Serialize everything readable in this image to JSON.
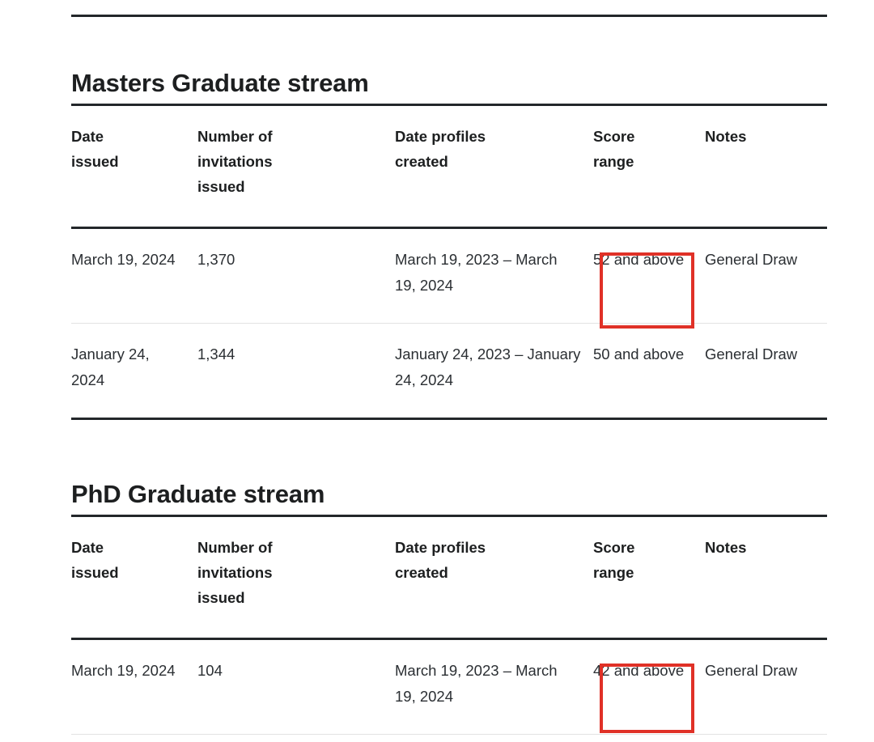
{
  "columns": [
    "Date issued",
    "Number of invitations issued",
    "Date profiles created",
    "Score range",
    "Notes"
  ],
  "columns_lines": {
    "c0_l1": "Date",
    "c0_l2": "issued",
    "c1_l1": "Number of",
    "c1_l2": "invitations",
    "c1_l3": "issued",
    "c2_l1": "Date profiles",
    "c2_l2": "created",
    "c3_l1": "Score",
    "c3_l2": "range",
    "c4_l1": "Notes"
  },
  "sections": [
    {
      "heading": "Masters Graduate stream",
      "rows": [
        {
          "date_issued": "March 19, 2024",
          "invitations": "1,370",
          "profiles_created": "March 19, 2023 – March 19, 2024",
          "score_range": "52 and above",
          "notes": "General Draw",
          "highlighted": true
        },
        {
          "date_issued": "January 24, 2024",
          "invitations": "1,344",
          "profiles_created": "January 24, 2023 – January 24, 2024",
          "score_range": "50 and above",
          "notes": "General Draw",
          "highlighted": false
        }
      ]
    },
    {
      "heading": "PhD Graduate stream",
      "rows": [
        {
          "date_issued": "March 19, 2024",
          "invitations": "104",
          "profiles_created": "March 19, 2023 – March 19, 2024",
          "score_range": "42 and above",
          "notes": "General Draw",
          "highlighted": true
        }
      ]
    }
  ],
  "annotation": {
    "color": "#e03127",
    "targets": [
      "52 and above",
      "42 and above"
    ]
  }
}
